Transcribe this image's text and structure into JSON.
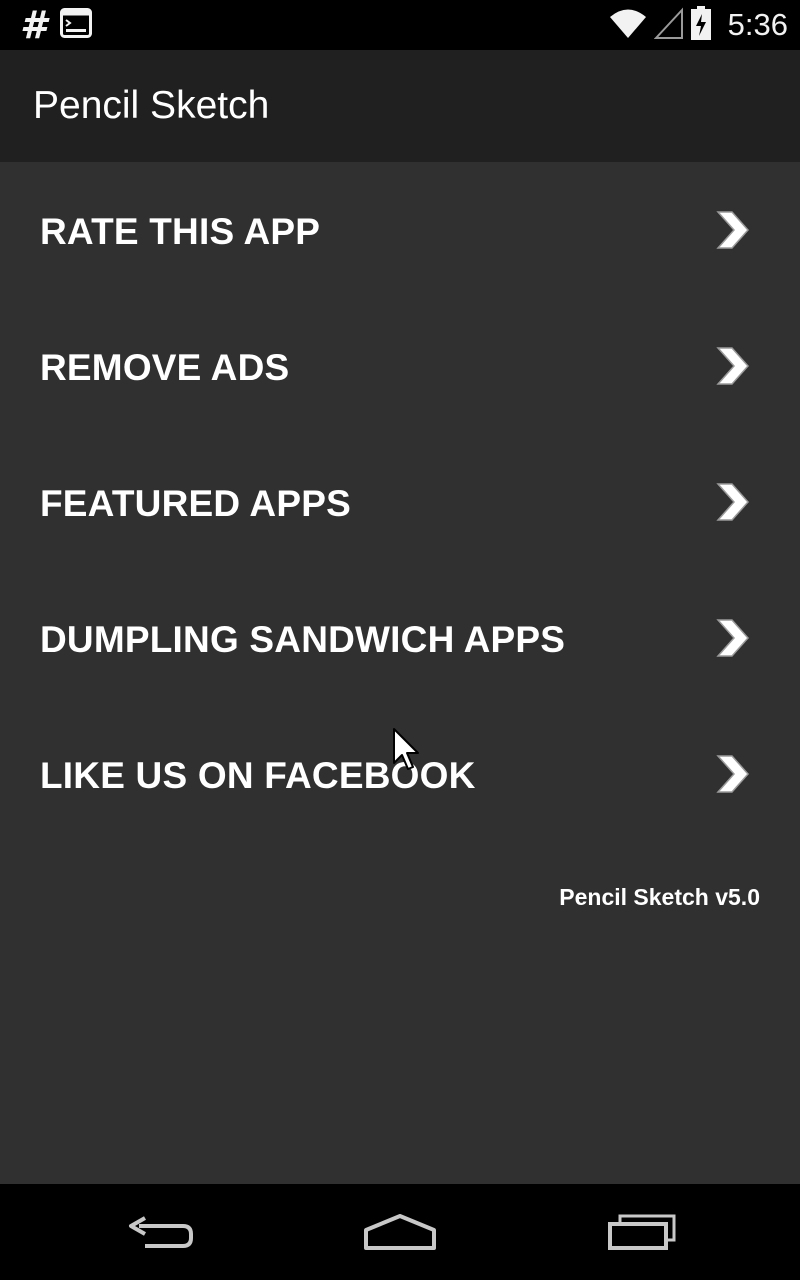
{
  "status_bar": {
    "left_icons": [
      "hash-icon",
      "terminal-icon"
    ],
    "right_icons": [
      "wifi-icon",
      "signal-icon",
      "battery-charging-icon"
    ],
    "hash_glyph": "#",
    "time": "5:36"
  },
  "action_bar": {
    "title": "Pencil Sketch"
  },
  "menu": {
    "items": [
      {
        "label": "RATE THIS APP",
        "icon": "chevron-right-icon"
      },
      {
        "label": "REMOVE ADS",
        "icon": "chevron-right-icon"
      },
      {
        "label": "FEATURED APPS",
        "icon": "chevron-right-icon"
      },
      {
        "label": "DUMPLING SANDWICH APPS",
        "icon": "chevron-right-icon"
      },
      {
        "label": "LIKE US ON FACEBOOK",
        "icon": "chevron-right-icon"
      }
    ]
  },
  "footer": {
    "version": "Pencil Sketch v5.0"
  },
  "nav_bar": {
    "buttons": [
      "back-icon",
      "home-icon",
      "recents-icon"
    ]
  },
  "colors": {
    "background": "#303030",
    "action_bar": "#202020",
    "status_bar": "#000000",
    "text": "#ffffff"
  }
}
